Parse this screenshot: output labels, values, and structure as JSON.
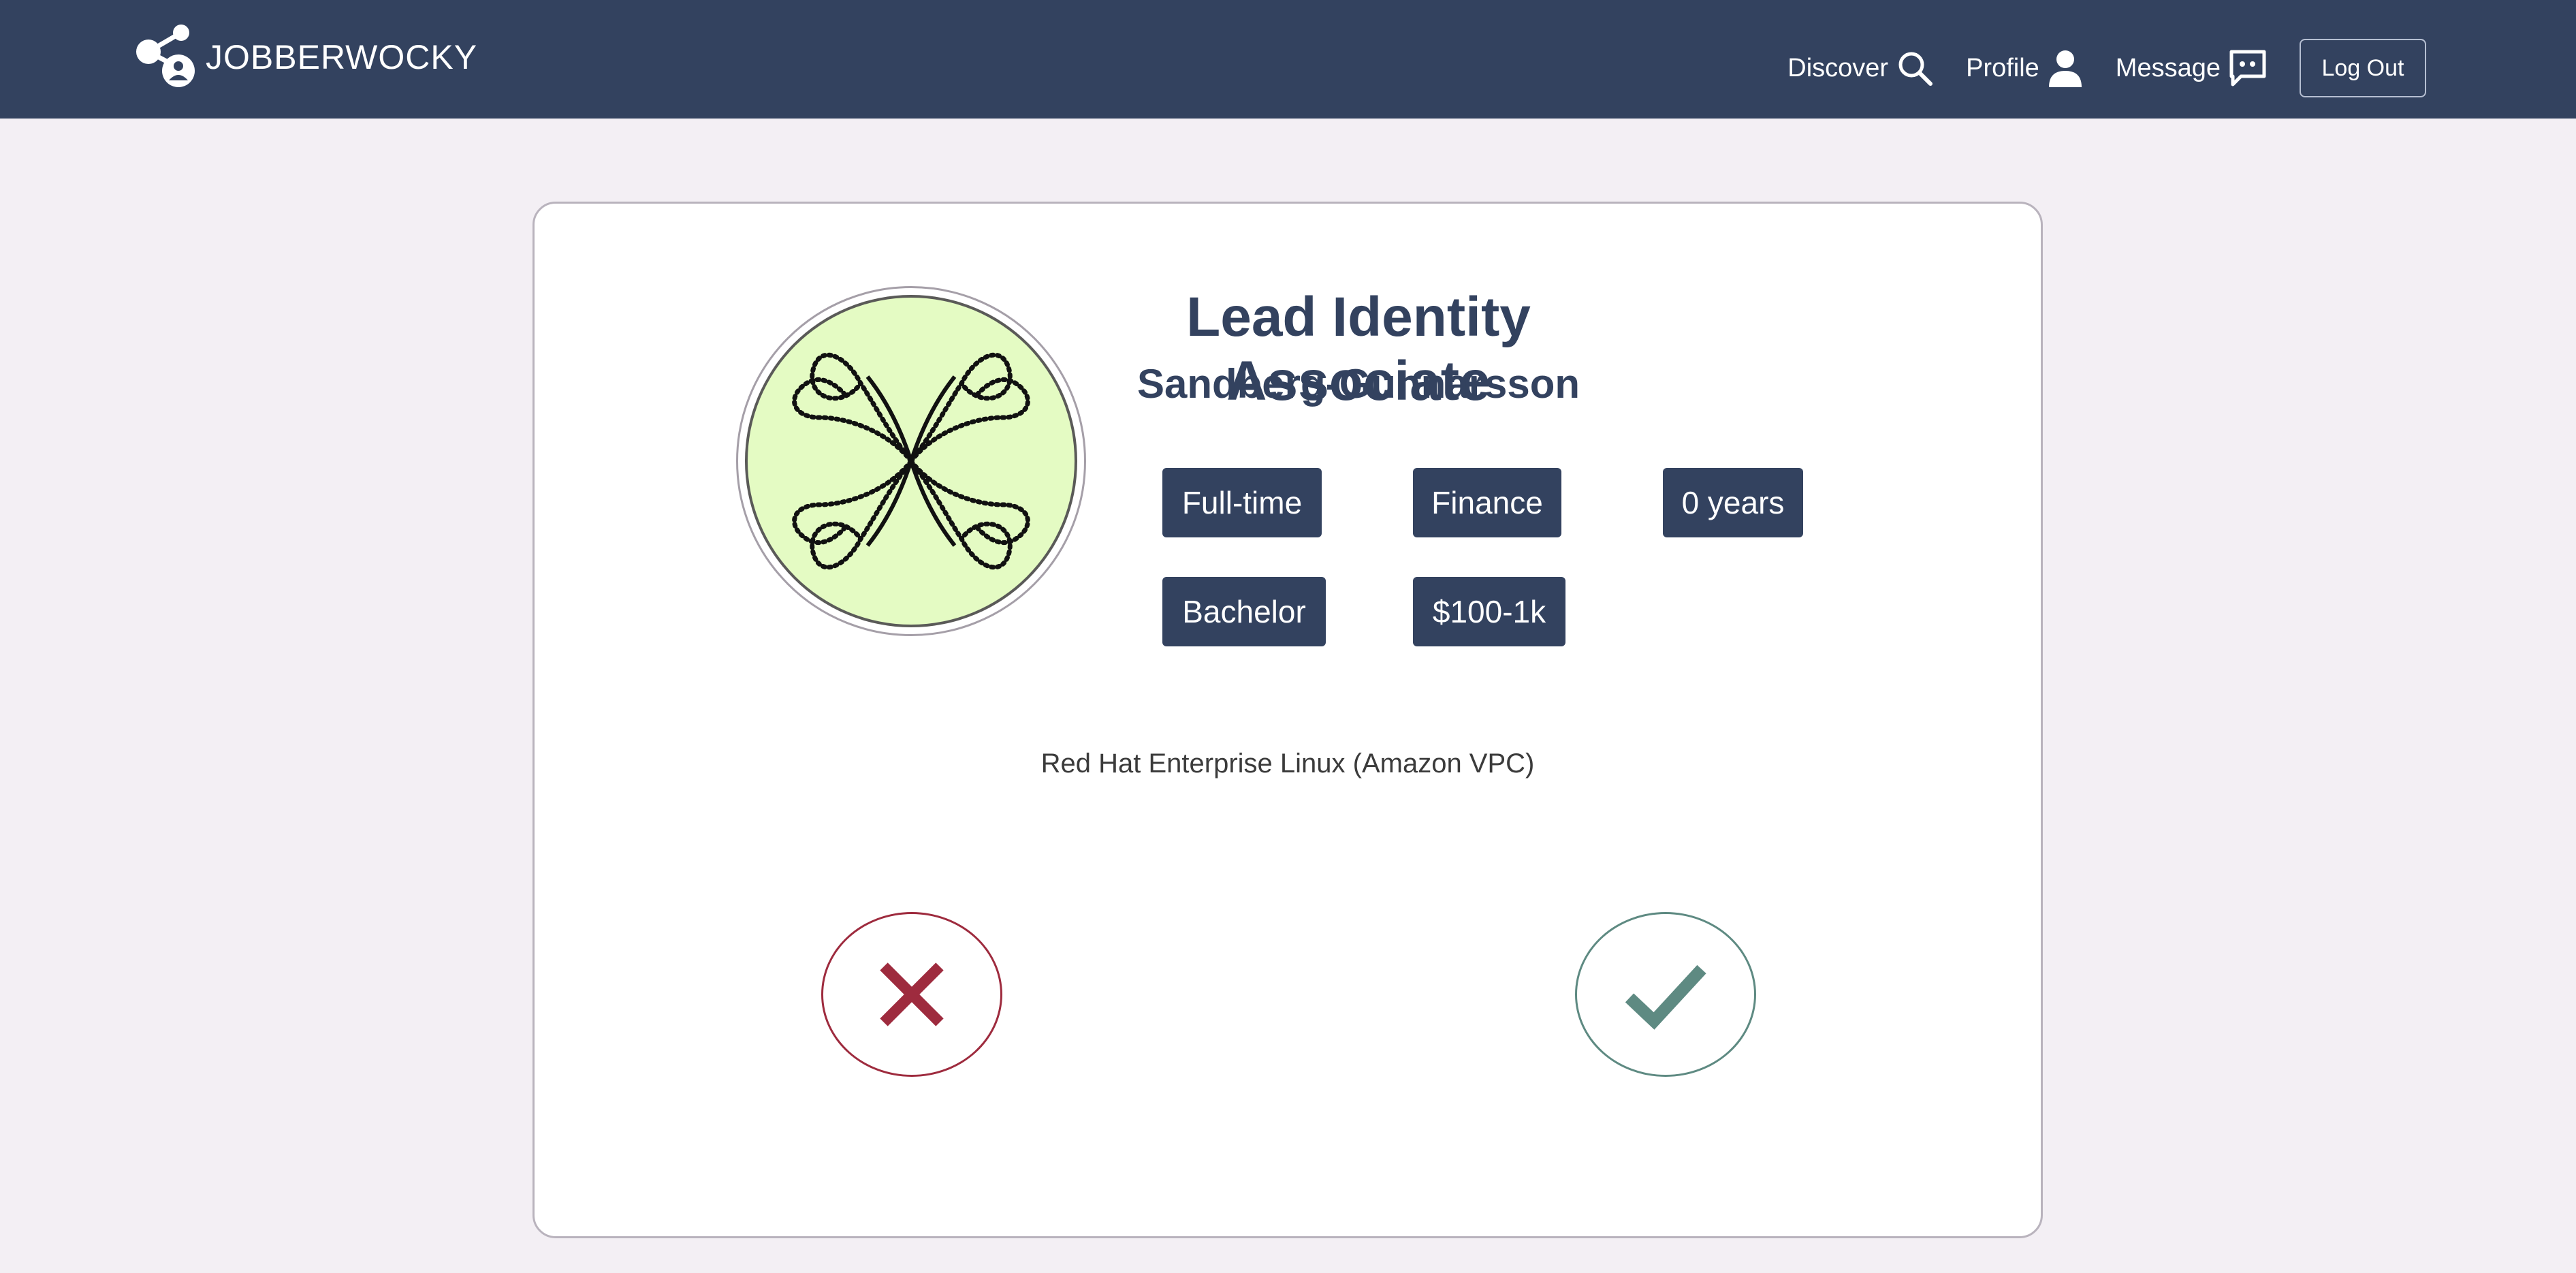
{
  "nav": {
    "brand": "JOBBERWOCKY",
    "links": [
      {
        "label": "Discover",
        "icon": "search-icon"
      },
      {
        "label": "Profile",
        "icon": "user-icon"
      },
      {
        "label": "Message",
        "icon": "chat-icon"
      }
    ],
    "logout_label": "Log Out"
  },
  "job": {
    "title": "Lead Identity Associate",
    "company": "Sandberg-Gunnarsson",
    "tags": [
      "Full-time",
      "Finance",
      "0 years",
      "Bachelor",
      "$100-1k"
    ],
    "description": "Red Hat Enterprise Linux (Amazon VPC)"
  },
  "actions": {
    "reject_icon": "close-icon",
    "accept_icon": "checkmark-icon"
  },
  "colors": {
    "navbar": "#33425f",
    "background": "#f3eff4",
    "tag_bg": "#33425f",
    "reject": "#9e2b3e",
    "accept": "#5e8a82",
    "avatar_bg": "#e4fbc3"
  }
}
